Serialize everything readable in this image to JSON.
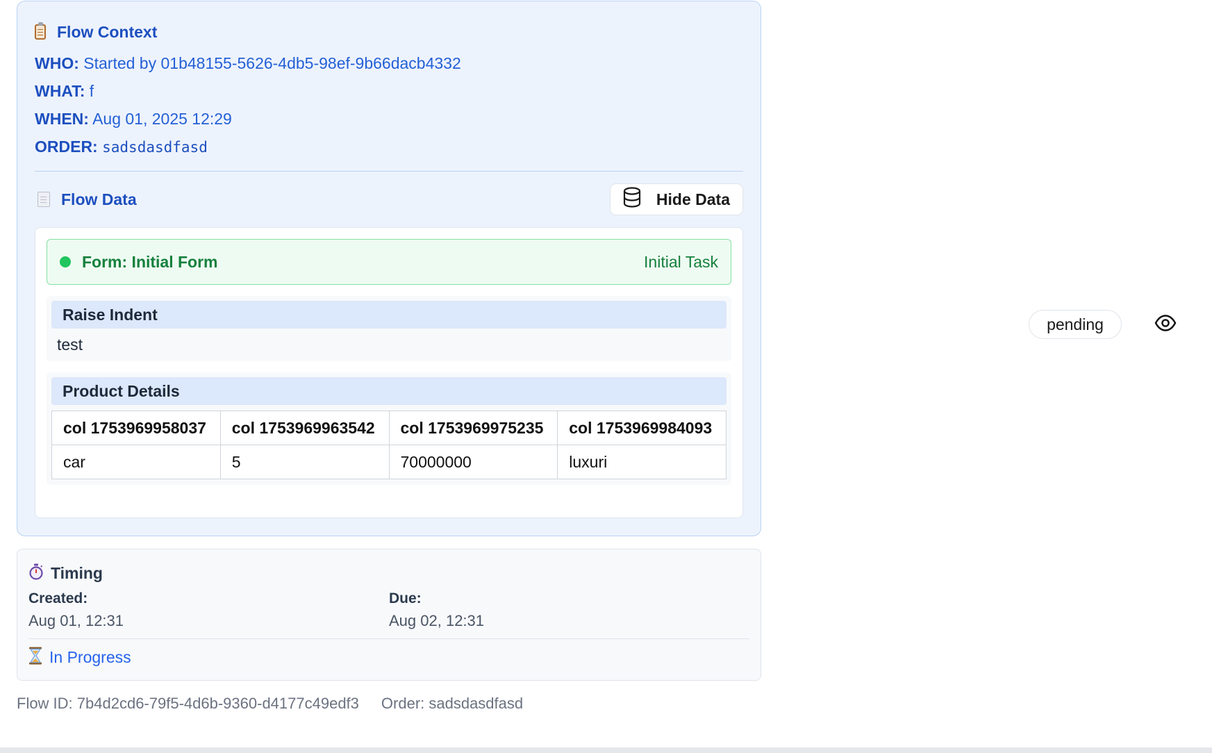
{
  "context": {
    "title": "Flow Context",
    "icon": "clipboard-icon",
    "who_label": "WHO:",
    "who_value": "Started by 01b48155-5626-4db5-98ef-9b66dacb4332",
    "what_label": "WHAT:",
    "what_value": "f",
    "when_label": "WHEN:",
    "when_value": "Aug 01, 2025 12:29",
    "order_label": "ORDER:",
    "order_value": "sadsdasdfasd"
  },
  "flow_data": {
    "title": "Flow Data",
    "icon": "document-icon",
    "hide_button_label": "Hide Data",
    "hide_button_icon": "database-icon",
    "form": {
      "title": "Form: Initial Form",
      "task": "Initial Task",
      "status_color": "#22c55e"
    },
    "raise_indent": {
      "label": "Raise Indent",
      "value": "test"
    },
    "product_details": {
      "label": "Product Details",
      "columns": [
        "col 1753969958037",
        "col 1753969963542",
        "col 1753969975235",
        "col 1753969984093"
      ],
      "rows": [
        [
          "car",
          "5",
          "70000000",
          "luxuri"
        ]
      ]
    }
  },
  "timing": {
    "title": "Timing",
    "icon": "stopwatch-icon",
    "created_label": "Created:",
    "created_value": "Aug 01, 12:31",
    "due_label": "Due:",
    "due_value": "Aug 02, 12:31",
    "status": "In Progress",
    "status_icon": "hourglass-icon"
  },
  "footer": {
    "flow_id": "Flow ID: 7b4d2cd6-79f5-4d6b-9360-d4177c49edf3",
    "order": "Order: sadsdasdfasd"
  },
  "status_badge": "pending",
  "view_icon": "eye-icon",
  "colors": {
    "accent": "#1d4fbf",
    "context_bg": "#edf3fd",
    "success": "#15803d",
    "in_progress": "#2563eb"
  }
}
